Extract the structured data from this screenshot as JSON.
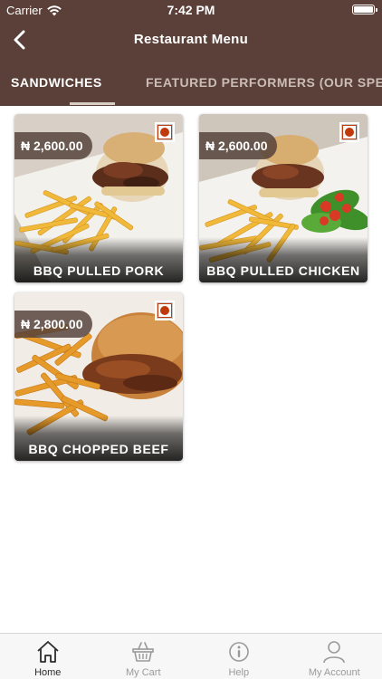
{
  "status_bar": {
    "carrier": "Carrier",
    "time": "7:42 PM"
  },
  "nav": {
    "title": "Restaurant Menu",
    "back_icon": "chevron-left-icon"
  },
  "tabs": [
    {
      "label": "SANDWICHES",
      "active": true
    },
    {
      "label": "FEATURED PERFORMERS (OUR SPE",
      "active": false
    }
  ],
  "menu_items": [
    {
      "name": "BBQ PULLED PORK",
      "price": "₦ 2,600.00",
      "badge_icon": "non-veg-indicator-icon"
    },
    {
      "name": "BBQ PULLED CHICKEN",
      "price": "₦ 2,600.00",
      "badge_icon": "non-veg-indicator-icon"
    },
    {
      "name": "BBQ CHOPPED BEEF",
      "price": "₦ 2,800.00",
      "badge_icon": "non-veg-indicator-icon"
    }
  ],
  "bottom_tabs": [
    {
      "label": "Home",
      "icon": "home-icon",
      "active": true
    },
    {
      "label": "My Cart",
      "icon": "basket-icon",
      "active": false
    },
    {
      "label": "Help",
      "icon": "info-icon",
      "active": false
    },
    {
      "label": "My Account",
      "icon": "user-icon",
      "active": false
    }
  ],
  "colors": {
    "header": "#5a4038",
    "badge": "#c0390b",
    "tab_bar": "#f7f7f7"
  }
}
